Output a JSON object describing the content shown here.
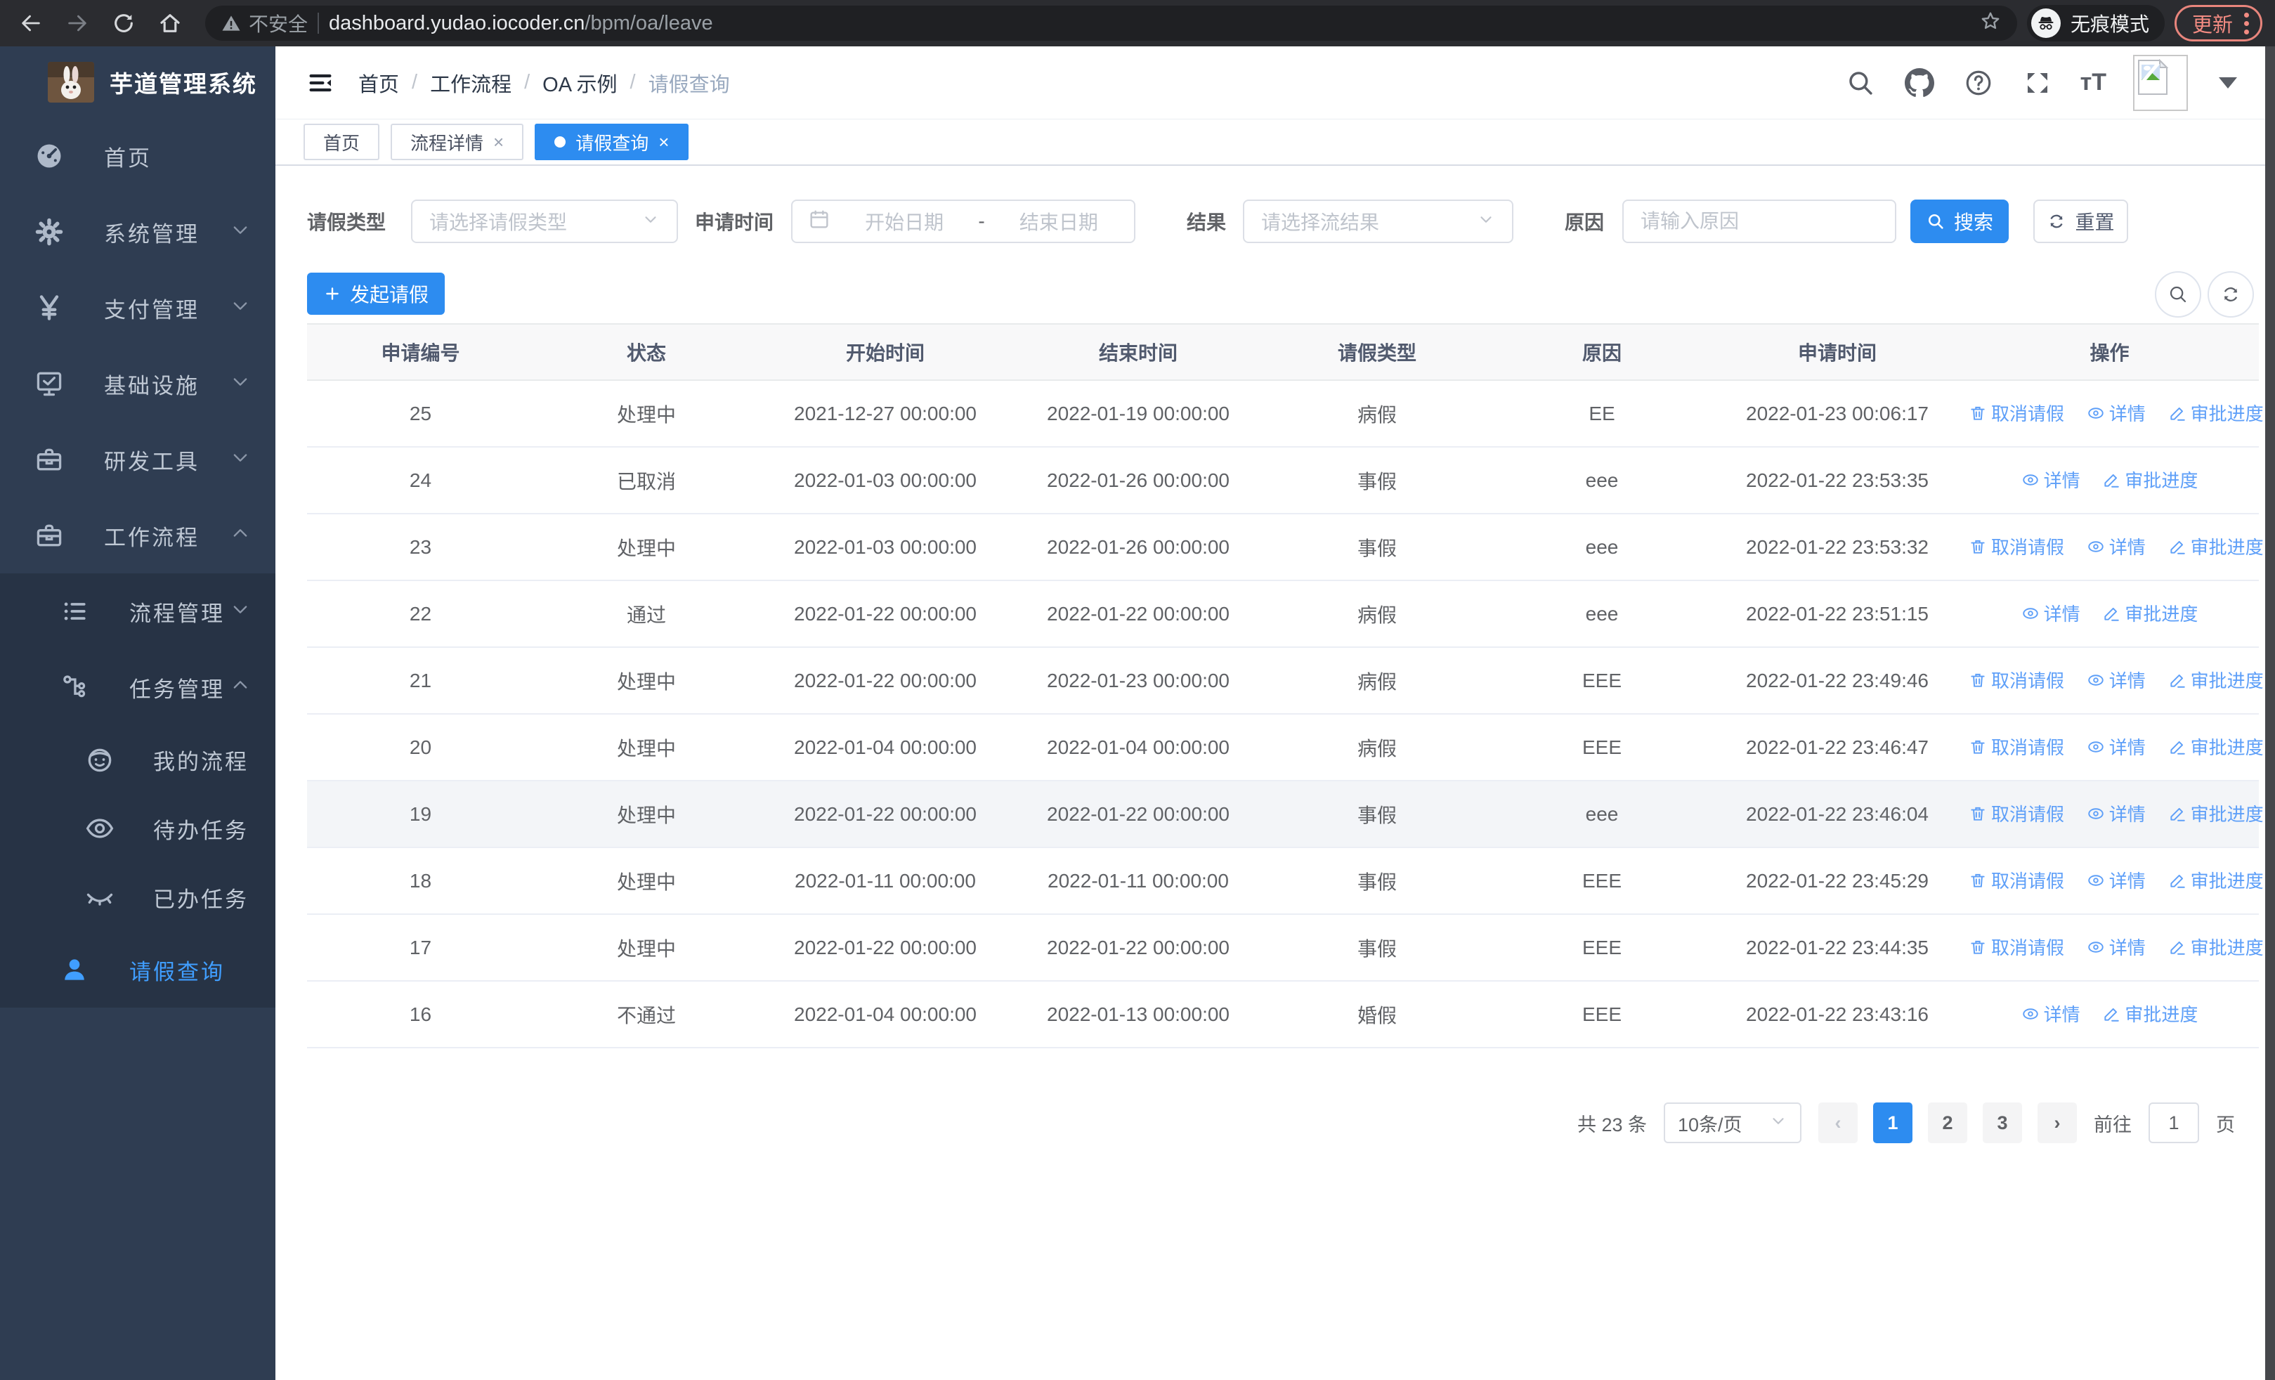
{
  "browser": {
    "security_label": "不安全",
    "url_host": "dashboard.yudao.iocoder.cn",
    "url_path": "/bpm/oa/leave",
    "incognito_label": "无痕模式",
    "update_label": "更新"
  },
  "sidebar": {
    "title": "芋道管理系统",
    "menu": {
      "home": "首页",
      "system": "系统管理",
      "pay": "支付管理",
      "infra": "基础设施",
      "dev": "研发工具",
      "workflow": "工作流程",
      "process_mgmt": "流程管理",
      "task_mgmt": "任务管理",
      "my_process": "我的流程",
      "todo": "待办任务",
      "done": "已办任务",
      "leave_query": "请假查询"
    }
  },
  "header": {
    "breadcrumb": [
      "首页",
      "工作流程",
      "OA 示例",
      "请假查询"
    ],
    "separator": "/"
  },
  "tabs": [
    {
      "label": "首页"
    },
    {
      "label": "流程详情",
      "close": "×"
    },
    {
      "label": "请假查询",
      "close": "×",
      "active": true
    }
  ],
  "filters": {
    "leave_type_label": "请假类型",
    "leave_type_placeholder": "请选择请假类型",
    "apply_time_label": "申请时间",
    "start_placeholder": "开始日期",
    "range_separator": "-",
    "end_placeholder": "结束日期",
    "result_label": "结果",
    "result_placeholder": "请选择流结果",
    "reason_label": "原因",
    "reason_placeholder": "请输入原因",
    "search_label": "搜索",
    "reset_label": "重置"
  },
  "toolbar": {
    "create_label": "发起请假"
  },
  "table": {
    "columns": [
      "申请编号",
      "状态",
      "开始时间",
      "结束时间",
      "请假类型",
      "原因",
      "申请时间",
      "操作"
    ],
    "action_labels": {
      "cancel": "取消请假",
      "detail": "详情",
      "progress": "审批进度"
    },
    "rows": [
      {
        "id": "25",
        "status": "处理中",
        "start": "2021-12-27 00:00:00",
        "end": "2022-01-19 00:00:00",
        "type": "病假",
        "reason": "EE",
        "apply_time": "2022-01-23 00:06:17",
        "actions": [
          "cancel",
          "detail",
          "progress"
        ]
      },
      {
        "id": "24",
        "status": "已取消",
        "start": "2022-01-03 00:00:00",
        "end": "2022-01-26 00:00:00",
        "type": "事假",
        "reason": "eee",
        "apply_time": "2022-01-22 23:53:35",
        "actions": [
          "detail",
          "progress"
        ]
      },
      {
        "id": "23",
        "status": "处理中",
        "start": "2022-01-03 00:00:00",
        "end": "2022-01-26 00:00:00",
        "type": "事假",
        "reason": "eee",
        "apply_time": "2022-01-22 23:53:32",
        "actions": [
          "cancel",
          "detail",
          "progress"
        ]
      },
      {
        "id": "22",
        "status": "通过",
        "start": "2022-01-22 00:00:00",
        "end": "2022-01-22 00:00:00",
        "type": "病假",
        "reason": "eee",
        "apply_time": "2022-01-22 23:51:15",
        "actions": [
          "detail",
          "progress"
        ]
      },
      {
        "id": "21",
        "status": "处理中",
        "start": "2022-01-22 00:00:00",
        "end": "2022-01-23 00:00:00",
        "type": "病假",
        "reason": "EEE",
        "apply_time": "2022-01-22 23:49:46",
        "actions": [
          "cancel",
          "detail",
          "progress"
        ]
      },
      {
        "id": "20",
        "status": "处理中",
        "start": "2022-01-04 00:00:00",
        "end": "2022-01-04 00:00:00",
        "type": "病假",
        "reason": "EEE",
        "apply_time": "2022-01-22 23:46:47",
        "actions": [
          "cancel",
          "detail",
          "progress"
        ]
      },
      {
        "id": "19",
        "status": "处理中",
        "start": "2022-01-22 00:00:00",
        "end": "2022-01-22 00:00:00",
        "type": "事假",
        "reason": "eee",
        "apply_time": "2022-01-22 23:46:04",
        "actions": [
          "cancel",
          "detail",
          "progress"
        ],
        "highlighted": true
      },
      {
        "id": "18",
        "status": "处理中",
        "start": "2022-01-11 00:00:00",
        "end": "2022-01-11 00:00:00",
        "type": "事假",
        "reason": "EEE",
        "apply_time": "2022-01-22 23:45:29",
        "actions": [
          "cancel",
          "detail",
          "progress"
        ]
      },
      {
        "id": "17",
        "status": "处理中",
        "start": "2022-01-22 00:00:00",
        "end": "2022-01-22 00:00:00",
        "type": "事假",
        "reason": "EEE",
        "apply_time": "2022-01-22 23:44:35",
        "actions": [
          "cancel",
          "detail",
          "progress"
        ]
      },
      {
        "id": "16",
        "status": "不通过",
        "start": "2022-01-04 00:00:00",
        "end": "2022-01-13 00:00:00",
        "type": "婚假",
        "reason": "EEE",
        "apply_time": "2022-01-22 23:43:16",
        "actions": [
          "detail",
          "progress"
        ]
      }
    ]
  },
  "pagination": {
    "total_label": "共 23 条",
    "page_size_label": "10条/页",
    "pages": [
      "1",
      "2",
      "3"
    ],
    "prev": "‹",
    "next": "›",
    "goto_label": "前往",
    "goto_value": "1",
    "page_unit": "页"
  },
  "colors": {
    "primary": "#2d8cf0",
    "link_blue": "#5e9ff8",
    "sidebar_active": "#409eff",
    "update_badge": "#f28b82"
  }
}
